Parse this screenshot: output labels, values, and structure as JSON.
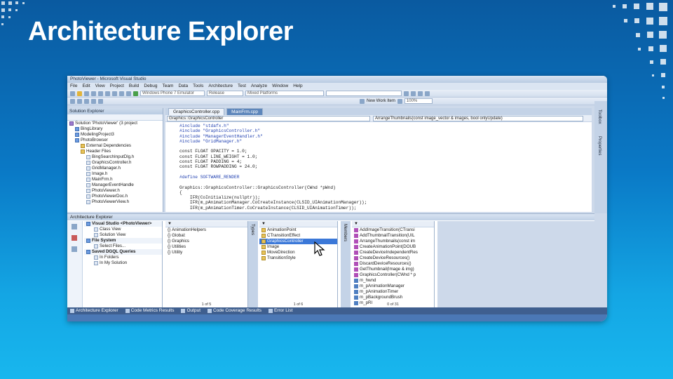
{
  "slide": {
    "title": "Architecture Explorer"
  },
  "window": {
    "title": "PhotoViewer - Microsoft Visual Studio",
    "menu": [
      "File",
      "Edit",
      "View",
      "Project",
      "Build",
      "Debug",
      "Team",
      "Data",
      "Tools",
      "Architecture",
      "Test",
      "Analyze",
      "Window",
      "Help"
    ],
    "toolbar": {
      "device_combo": "Windows Phone 7 Emulator",
      "config_combo": "Release",
      "platform_combo": "Mixed Platforms",
      "new_work_item": "New Work Item",
      "zoom": "100%"
    }
  },
  "solution_explorer": {
    "title": "Solution Explorer",
    "items": [
      {
        "label": "Solution 'PhotoViewer' (3 project",
        "icon": "solution-icon",
        "indent": 0
      },
      {
        "label": "BingLibrary",
        "icon": "project-icon",
        "indent": 1
      },
      {
        "label": "ModelingProject3",
        "icon": "project-icon",
        "indent": 1
      },
      {
        "label": "PhotoBrowser",
        "icon": "project-icon",
        "indent": 1
      },
      {
        "label": "External Dependencies",
        "icon": "folder-icon",
        "indent": 2
      },
      {
        "label": "Header Files",
        "icon": "folder-icon",
        "indent": 2
      },
      {
        "label": "BingSearchInputDlg.h",
        "icon": "file-icon",
        "indent": 3
      },
      {
        "label": "GraphicsController.h",
        "icon": "file-icon",
        "indent": 3
      },
      {
        "label": "GridManager.h",
        "icon": "file-icon",
        "indent": 3
      },
      {
        "label": "Image.h",
        "icon": "file-icon",
        "indent": 3
      },
      {
        "label": "MainFrm.h",
        "icon": "file-icon",
        "indent": 3
      },
      {
        "label": "ManagerEventHandle",
        "icon": "file-icon",
        "indent": 3
      },
      {
        "label": "PhotoViewer.h",
        "icon": "file-icon",
        "indent": 3
      },
      {
        "label": "PhotoViewerDoc.h",
        "icon": "file-icon",
        "indent": 3
      },
      {
        "label": "PhotoViewerView.h",
        "icon": "file-icon",
        "indent": 3
      }
    ]
  },
  "editor": {
    "tabs": [
      "GraphicsController.cpp",
      "MainFrm.cpp"
    ],
    "nav_left": "Graphics::GraphicsController",
    "nav_right": "ArrangeThumbnails(const image_vector & images, bool onlyUpdate)",
    "code_lines": [
      "#include \"stdafx.h\"",
      "#include \"GraphicsController.h\"",
      "#include \"ManagerEventHandler.h\"",
      "#include \"GridManager.h\"",
      "",
      "const FLOAT OPACITY = 1.0;",
      "const FLOAT LINE_WEIGHT = 1.0;",
      "const FLOAT PADDING = 4;",
      "const FLOAT ROWPADDING = 24.0;",
      "",
      "#define SOFTWARE_RENDER",
      "",
      "Graphics::GraphicsController::GraphicsController(CWnd *pWnd)",
      "{",
      "    IFR(CoInitialize(nullptr));",
      "    IFR(m_pAnimationManager.CoCreateInstance(CLSID_UIAnimationManager));",
      "    IFR(m_pAnimationTimer.CoCreateInstance(CLSID_UIAnimationTimer));"
    ]
  },
  "side_strip": {
    "toolbox": "Toolbox",
    "properties": "Properties"
  },
  "architecture_explorer": {
    "title": "Architecture Explorer",
    "col1": {
      "sections": [
        {
          "title": "Visual Studio <PhotoViewer>",
          "items": [
            "Class View",
            "Solution View"
          ]
        },
        {
          "title": "File System",
          "items": [
            "Select Files..."
          ]
        },
        {
          "title": "Saved DGQL Queries",
          "items": [
            "In Folders",
            "In My Solution"
          ]
        }
      ]
    },
    "col2": {
      "items": [
        "AnimationHelpers",
        "Global:",
        "Graphics",
        "Utilities",
        "Utility"
      ],
      "count": "1 of 5"
    },
    "col2_side": "Types",
    "col3": {
      "items": [
        "AnimationPoint",
        "CTransitionEffect",
        "GraphicsController",
        "Image",
        "MoveDirection",
        "TransitionStyle"
      ],
      "selected": "GraphicsController",
      "count": "1 of 6"
    },
    "col3_side": "Members",
    "col4": {
      "items": [
        "AddImageTransition(CTransi",
        "AddThumbnailTransition(UIL",
        "ArrangeThumbnails(const im",
        "CreateAnimationPoint(DOUB",
        "CreateDeviceIndependentRes",
        "CreateDeviceResources()",
        "DiscardDeviceResources()",
        "GetThumbnail(Image & img)",
        "GraphicsController(CWnd * p",
        "m_hwnd",
        "m_pAnimationManager",
        "m_pAnimationTimer",
        "m_pBackgroundBrush",
        "m_pRI"
      ],
      "count": "0 of 31"
    }
  },
  "bottom_tabs": [
    "Architecture Explorer",
    "Code Metrics Results",
    "Output",
    "Code Coverage Results",
    "Error List"
  ]
}
